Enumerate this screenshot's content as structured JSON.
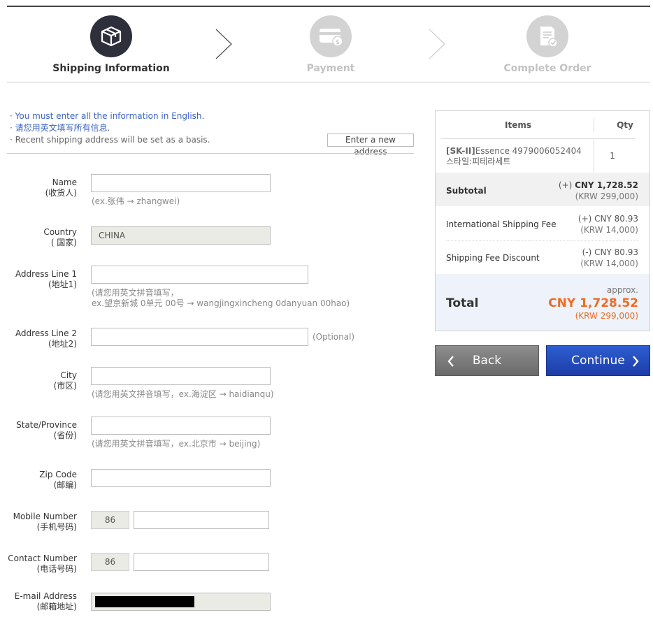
{
  "steps": [
    {
      "label": "Shipping Information",
      "icon": "package-icon",
      "state": "active"
    },
    {
      "label": "Payment",
      "icon": "card-payment-icon",
      "state": "inactive"
    },
    {
      "label": "Complete Order",
      "icon": "order-document-icon",
      "state": "inactive"
    }
  ],
  "notices": [
    "· You must enter all the information in English.",
    "· 请您用英文填写所有信息.",
    "· Recent shipping address will be set as a basis."
  ],
  "new_address_button": "Enter a new address",
  "form": {
    "name": {
      "label": "Name",
      "label_cn": "(收货人)",
      "hint": "(ex.张伟 → zhangwei)"
    },
    "country": {
      "label": "Country",
      "label_cn": "( 国家)",
      "value": "CHINA"
    },
    "address1": {
      "label": "Address Line 1",
      "label_cn": "(地址1)",
      "hint1": "(请您用英文拼音填写，",
      "hint2": "ex.望京新城 0单元 00号 → wangjingxincheng 0danyuan 00hao)"
    },
    "address2": {
      "label": "Address Line 2",
      "label_cn": "(地址2)",
      "optional": "(Optional)"
    },
    "city": {
      "label": "City",
      "label_cn": "(市区)",
      "hint": "(请您用英文拼音填写，ex.海淀区 → haidianqu)"
    },
    "state": {
      "label": "State/Province",
      "label_cn": "(省份)",
      "hint": "(请您用英文拼音填写，ex.北京市 → beijing)"
    },
    "zip": {
      "label": "Zip Code",
      "label_cn": "(邮编)"
    },
    "mobile": {
      "label": "Mobile Number",
      "label_cn": "(手机号码)",
      "prefix": "86"
    },
    "contact": {
      "label": "Contact Number",
      "label_cn": "(电话号码)",
      "prefix": "86"
    },
    "email": {
      "label": "E-mail Address",
      "label_cn": "(邮箱地址)"
    }
  },
  "summary": {
    "col_items": "Items",
    "col_qty": "Qty",
    "item": {
      "brand": "[SK-II]",
      "name": "Essence 4979006052404",
      "option": "스타일:피테라세트",
      "qty": "1"
    },
    "subtotal": {
      "label": "Subtotal",
      "sign": "(+) ",
      "cny": "CNY 1,728.52",
      "krw": "(KRW 299,000)"
    },
    "intl_shipping": {
      "label": "International Shipping Fee",
      "cny": "(+) CNY 80.93",
      "krw": "(KRW 14,000)"
    },
    "shipping_discount": {
      "label": "Shipping Fee Discount",
      "cny": "(-) CNY 80.93",
      "krw": "(KRW 14,000)"
    },
    "total": {
      "label": "Total",
      "approx": "approx.",
      "cny": "CNY 1,728.52",
      "krw": "(KRW 299,000)"
    }
  },
  "buttons": {
    "back": "Back",
    "continue": "Continue"
  },
  "colors": {
    "accent_blue": "#1d3ca8",
    "total_orange": "#f36a21",
    "step_active": "#2d2f3a",
    "step_inactive": "#d3d3d3"
  }
}
